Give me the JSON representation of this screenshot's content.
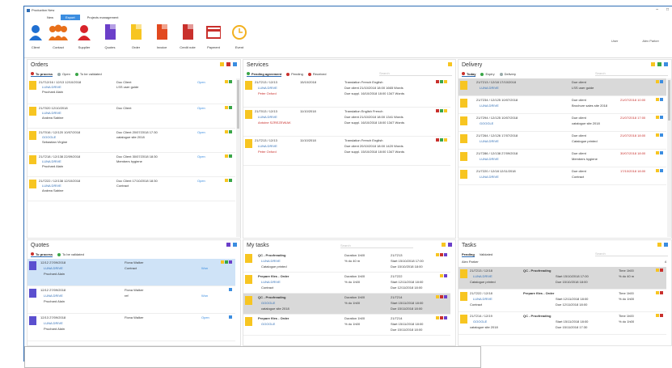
{
  "window": {
    "title": "Production New",
    "controls": [
      "–",
      "□"
    ]
  },
  "menu": [
    {
      "label": "New",
      "active": false
    },
    {
      "label": "Export",
      "active": true
    },
    {
      "label": "Projects management",
      "active": false
    }
  ],
  "ribbon": {
    "buttons": [
      {
        "label": "Client",
        "icon": "client-icon",
        "color": "#1f6fd1"
      },
      {
        "label": "Contact",
        "icon": "contact-icon",
        "color": "#e8701a"
      },
      {
        "label": "Supplier",
        "icon": "supplier-icon",
        "color": "#d8232a"
      },
      {
        "label": "Quotes",
        "icon": "quotes-icon",
        "color": "#6b3fc9"
      },
      {
        "label": "Order",
        "icon": "order-icon",
        "color": "#f7c521"
      },
      {
        "label": "Invoice",
        "icon": "invoice-icon",
        "color": "#e2491f"
      },
      {
        "label": "Credit note",
        "icon": "credit-note-icon",
        "color": "#c9302c"
      },
      {
        "label": "Payment",
        "icon": "payment-icon",
        "color": "#c9302c"
      },
      {
        "label": "Event",
        "icon": "event-icon",
        "color": "#f2b01e"
      }
    ],
    "user_label": "User",
    "user_name": "Alex Parker"
  },
  "orders": {
    "title": "Orders",
    "tabs": [
      {
        "label": "To process",
        "active": true
      },
      {
        "label": "Open",
        "active": false
      },
      {
        "label": "To be validated",
        "active": false
      }
    ],
    "rows": [
      {
        "ref": "21/712/16 / 12/13 12/10/2018",
        "client": "LUNA DRIVE",
        "who": "Pruchard Alain",
        "type": "Doc Client",
        "note": "LSS user guide",
        "status": "Open"
      },
      {
        "ref": "21/7020 12/10/2018",
        "client": "LUNA DRIVE",
        "who": "Andrea Sabine",
        "type": "Doc Client",
        "note": "",
        "status": "Open"
      },
      {
        "ref": "21/7016 / 12/120 10/07/2018",
        "client": "GOOGLE",
        "who": "Sebastian Virgine",
        "type": "Doc Client 20/07/2018 17:30",
        "note": "catalogue site 2018",
        "status": "Open"
      },
      {
        "ref": "21/7218 / 12/138 22/09/2018",
        "client": "LUNA DRIVE",
        "who": "Pruchard Alain",
        "type": "Doc Client 30/07/2018 18:30",
        "note": "Members hygiene",
        "status": "Open"
      },
      {
        "ref": "21/7222 / 12/138 12/10/2018",
        "client": "LUNA DRIVE",
        "who": "Andrea Sabine",
        "type": "Doc Client 17/10/2018 18:30",
        "note": "Contract",
        "status": "Open"
      }
    ]
  },
  "services": {
    "title": "Services",
    "tabs": [
      {
        "label": "Pending agreement",
        "active": true
      },
      {
        "label": "Pending",
        "active": false
      },
      {
        "label": "Received",
        "active": false
      }
    ],
    "search": "Search",
    "rows": [
      {
        "ref": "21/7213 / 12/13",
        "date": "15/10/2018",
        "desc": "Translation French English",
        "client": "LUNA DRIVE",
        "who": "Peter Oxford",
        "due1": "Due client  21/10/2018 18:00  1665 Words",
        "due2": "Due suppl.  16/10/2018 18:00  1347 Words"
      },
      {
        "ref": "21/7013 / 12/13",
        "date": "11/10/2018",
        "desc": "Translation English French",
        "client": "LUNA DRIVE",
        "who": "Antoine SZREZEWIAK",
        "due1": "Due client  21/10/2018 18:00  1341 Words",
        "due2": "Due suppl.  16/10/2018 18:00  1347 Words"
      },
      {
        "ref": "21/7213 / 12/13",
        "date": "11/10/2018",
        "desc": "Translation French English",
        "client": "LUNA DRIVE",
        "who": "Peter Oxford",
        "due1": "Due client  20/10/2018 18:00  1420 Words",
        "due2": "Due suppl.  15/10/2018 18:00  1347 Words"
      }
    ]
  },
  "delivery": {
    "title": "Delivery",
    "tabs": [
      {
        "label": "Today",
        "active": true
      },
      {
        "label": "Expiry",
        "active": false
      },
      {
        "label": "Delivery",
        "active": false
      }
    ],
    "search": "Search",
    "rows": [
      {
        "ref": "21/7213 / 12/18 17/10/2018",
        "client": "LUNA DRIVE",
        "due": "Due client",
        "note": "LSS user guide",
        "date": ""
      },
      {
        "ref": "21/7234 / 12/125 10/07/2018",
        "client": "LUNA DRIVE",
        "due": "Due client",
        "note": "Brochure sales site 2018",
        "date": "21/07/2018 10:00"
      },
      {
        "ref": "21/7294 / 12/125 10/07/2018",
        "client": "GOOGLE",
        "due": "Due client",
        "note": "catalogue site 2018",
        "date": "21/07/2018 17:00"
      },
      {
        "ref": "21/7264 / 12/126 17/07/2018",
        "client": "LUNA DRIVE",
        "due": "Due client",
        "note": "Catalogue printed",
        "date": "21/07/2018 18:00"
      },
      {
        "ref": "21/7286 / 12/138 27/09/2018",
        "client": "LUNA DRIVE",
        "due": "Due client",
        "note": "Members hygiene",
        "date": "30/07/2018 18:00"
      },
      {
        "ref": "21/7220 / 12/18 12/11/2018",
        "client": "LUNA DRIVE",
        "due": "Due client",
        "note": "Contract",
        "date": "17/10/2018 18:00"
      }
    ]
  },
  "quotes": {
    "title": "Quotes",
    "tabs": [
      {
        "label": "To process",
        "active": true
      },
      {
        "label": "To be validated",
        "active": false
      }
    ],
    "rows": [
      {
        "ref": "12/12 27/09/2018",
        "client": "LUNA DRIVE",
        "who": "Pruchard Alain",
        "contact": "Fiona Walker",
        "note": "Contract",
        "status": "Won",
        "selected": true
      },
      {
        "ref": "12/12 27/09/2018",
        "client": "LUNA DRIVE",
        "who": "Pruchard Alain",
        "contact": "Fiona Walker",
        "note": "ref",
        "status": "Won",
        "selected": false
      },
      {
        "ref": "12/13 27/09/2018",
        "client": "LUNA DRIVE",
        "who": "Pruchard Alain",
        "contact": "Fiona Walker",
        "note": "",
        "status": "Open",
        "selected": false
      }
    ]
  },
  "mytasks": {
    "title": "My tasks",
    "search": "Search",
    "rows": [
      {
        "task": "QC - Proofreading",
        "client": "LUNA DRIVE",
        "note": "Catalogue printed",
        "dur": "Duration 1h00",
        "pct": "% do  40 m",
        "start": "Start 15/10/2018 17:00",
        "due": "Due 15/10/2018 18:00",
        "ref": "21/7213",
        "style": "normal"
      },
      {
        "task": "Prepare files - Order",
        "client": "LUNA DRIVE",
        "note": "Contract",
        "dur": "Duration 1h00",
        "pct": "% do  1h00",
        "start": "Start 12/11/2018 18:00",
        "due": "Due 12/11/2018 18:00",
        "ref": "21/7222",
        "style": "normal"
      },
      {
        "task": "QC - Proofreading",
        "client": "GOOGLE",
        "note": "catalogue site 2018",
        "dur": "Duration 1h00",
        "pct": "% do  1h00",
        "start": "Start 15/11/2018 18:00",
        "due": "Due 15/11/2018 18:00",
        "ref": "21/7214",
        "style": "grey"
      },
      {
        "task": "Prepare files - Order",
        "client": "GOOGLE",
        "note": "",
        "dur": "Duration 1h00",
        "pct": "% do  1h00",
        "start": "Start 15/11/2018 18:00",
        "due": "Due 15/11/2018 18:00",
        "ref": "21/7214",
        "style": "normal"
      }
    ]
  },
  "tasks": {
    "title": "Tasks",
    "tabs": [
      {
        "label": "Pending",
        "active": true
      },
      {
        "label": "Validated",
        "active": false
      }
    ],
    "search": "Search",
    "user": "Alex Parker",
    "count": "4",
    "rows": [
      {
        "ref": "21/7213 / 12/18",
        "client": "LUNA DRIVE",
        "task": "QC - Proofreading",
        "note": "Catalogue printed",
        "start": "Start 15/10/2018 17:00",
        "due": "Due 15/10/2018 18:00",
        "time": "Time 1h00",
        "pct": "% do  40 m",
        "grey": true
      },
      {
        "ref": "21/7222 / 12/18",
        "client": "LUNA DRIVE",
        "task": "Prepare files - Order",
        "note": "Contract",
        "start": "Start 12/11/2018 18:00",
        "due": "Due 12/11/2018 18:00",
        "time": "Time 1h00",
        "pct": "% do  1h00",
        "grey": false
      },
      {
        "ref": "21/7214 / 12/19",
        "client": "GOOGLE",
        "task": "QC - Proofreading",
        "note": "catalogue site 2018",
        "start": "Start 15/11/2018 18:00",
        "due": "Due 15/11/2018 17:30",
        "time": "Time 1h00",
        "pct": "% do  1h00",
        "grey": false
      }
    ]
  }
}
